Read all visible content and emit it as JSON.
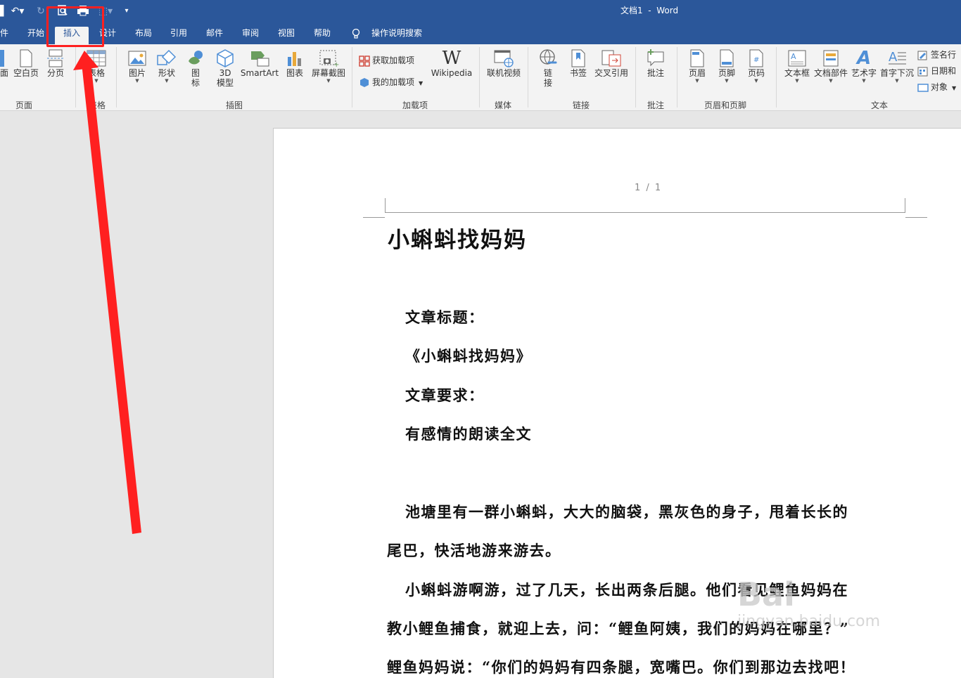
{
  "title_bar": {
    "document_title": "文档1  -  Word"
  },
  "tabs": [
    {
      "label": "件"
    },
    {
      "label": "开始"
    },
    {
      "label": "插入",
      "active": true
    },
    {
      "label": "设计"
    },
    {
      "label": "布局"
    },
    {
      "label": "引用"
    },
    {
      "label": "邮件"
    },
    {
      "label": "审阅"
    },
    {
      "label": "视图"
    },
    {
      "label": "帮助"
    },
    {
      "label": "操作说明搜索"
    }
  ],
  "ribbon": {
    "pages": {
      "cover": "面",
      "blank_page": "空白页",
      "page_break": "分页",
      "group_label": "页面"
    },
    "tables": {
      "table": "表格",
      "group_label": "表格"
    },
    "illustrations": {
      "pictures": "图片",
      "shapes": "形状",
      "icons_line1": "图",
      "icons_line2": "标",
      "model_line1": "3D",
      "model_line2": "模型",
      "smartart": "SmartArt",
      "chart": "图表",
      "screenshot": "屏幕截图",
      "group_label": "插图"
    },
    "addins": {
      "get_addins": "获取加载项",
      "my_addins": "我的加载项",
      "wikipedia": "Wikipedia",
      "group_label": "加载项"
    },
    "media": {
      "online_video": "联机视频",
      "group_label": "媒体"
    },
    "links": {
      "link_line1": "链",
      "link_line2": "接",
      "bookmark": "书签",
      "cross_reference": "交叉引用",
      "group_label": "链接"
    },
    "comments": {
      "comment": "批注",
      "group_label": "批注"
    },
    "header_footer": {
      "header": "页眉",
      "footer": "页脚",
      "page_number": "页码",
      "group_label": "页眉和页脚"
    },
    "text": {
      "text_box": "文本框",
      "quick_parts": "文档部件",
      "wordart": "艺术字",
      "drop_cap": "首字下沉",
      "signature_line": "签名行",
      "date_time": "日期和",
      "object": "对象",
      "group_label": "文本"
    }
  },
  "document": {
    "page_marker": "1 / 1",
    "heading": "小蝌蚪找妈妈",
    "paragraphs": [
      "文章标题：",
      "《小蝌蚪找妈妈》",
      "文章要求：",
      "有感情的朗读全文",
      "池塘里有一群小蝌蚪，大大的脑袋，黑灰色的身子，甩着长长的",
      "尾巴，快活地游来游去。",
      "小蝌蚪游啊游，过了几天，长出两条后腿。他们看见鲤鱼妈妈在",
      "教小鲤鱼捕食，就迎上去，问：“鲤鱼阿姨，我们的妈妈在哪里？”",
      "鲤鱼妈妈说：“你们的妈妈有四条腿，宽嘴巴。你们到那边去找吧！"
    ]
  },
  "watermark": {
    "line1": "Bai",
    "line2": "jingyan.baidu.com"
  },
  "colors": {
    "title_bar": "#2b579a",
    "ribbon": "#f3f3f3",
    "annotation": "#ff2020"
  }
}
